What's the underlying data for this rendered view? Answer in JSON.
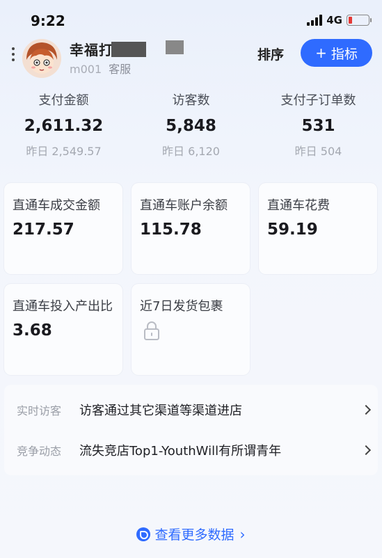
{
  "status_bar": {
    "time": "9:22",
    "network": "4G"
  },
  "header": {
    "shop_name": "幸福打",
    "account": "m001",
    "role": "客服",
    "sort_label": "排序",
    "add_metric_label": "指标"
  },
  "top_stats": [
    {
      "label": "支付金额",
      "value": "2,611.32",
      "prev": "昨日 2,549.57"
    },
    {
      "label": "访客数",
      "value": "5,848",
      "prev": "昨日 6,120"
    },
    {
      "label": "支付子订单数",
      "value": "531",
      "prev": "昨日 504"
    }
  ],
  "cards": [
    {
      "label": "直通车成交金额",
      "value": "217.57"
    },
    {
      "label": "直通车账户余额",
      "value": "115.78"
    },
    {
      "label": "直通车花费",
      "value": "59.19"
    },
    {
      "label": "直通车投入产出比",
      "value": "3.68"
    },
    {
      "label": "近7日发货包裹",
      "value": "",
      "locked": true
    }
  ],
  "info_rows": [
    {
      "tag": "实时访客",
      "text": "访客通过其它渠道等渠道进店"
    },
    {
      "tag": "竞争动态",
      "text": "流失竞店Top1-YouthWill有所谓青年"
    }
  ],
  "footer": {
    "more_data_label": "查看更多数据"
  },
  "colors": {
    "accent": "#2f6bff",
    "battery_low": "#e53935"
  }
}
